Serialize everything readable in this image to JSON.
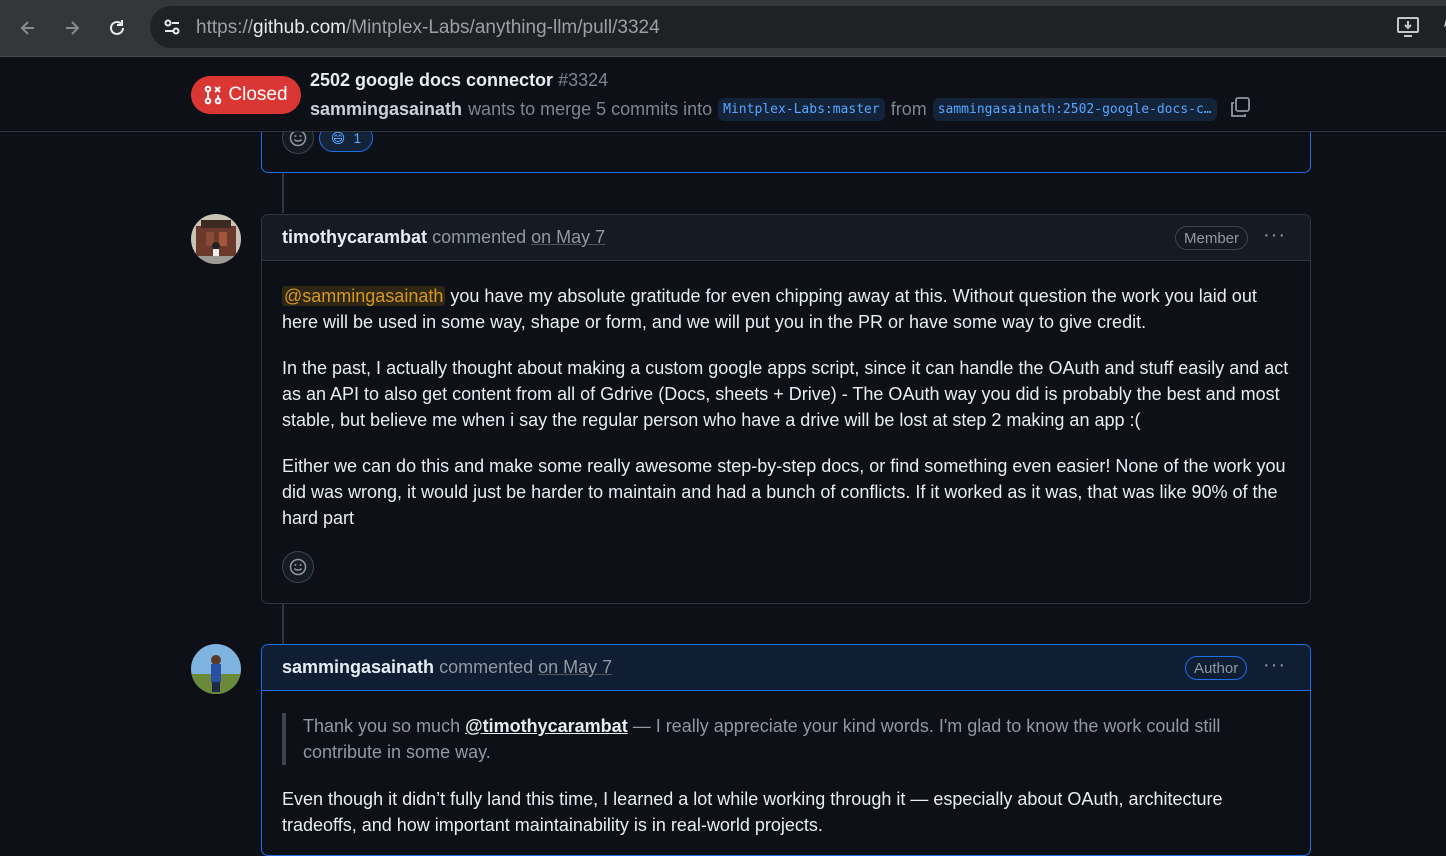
{
  "browser": {
    "url_scheme": "https://",
    "url_host": "github.com",
    "url_path": "/Mintplex-Labs/anything-llm/pull/3324"
  },
  "pr": {
    "state": "Closed",
    "title": "2502 google docs connector",
    "number": "#3324",
    "author": "sammingasainath",
    "merge_text": "wants to merge 5 commits into",
    "base_branch": "Mintplex-Labs:master",
    "from_text": "from",
    "head_branch": "sammingasainath:2502-google-docs-c…",
    "state_color": "#da3633"
  },
  "previous_reaction": {
    "emoji": "😄",
    "count": "1"
  },
  "comments": [
    {
      "user": "timothycarambat",
      "action": "commented",
      "date": "on May 7",
      "role": "Member",
      "mention": "@sammingasainath",
      "paragraph1_rest": " you have my absolute gratitude for even chipping away at this. Without question the work you laid out here will be used in some way, shape or form, and we will put you in the PR or have some way to give credit.",
      "paragraph2": "In the past, I actually thought about making a custom google apps script, since it can handle the OAuth and stuff easily and act as an API to also get content from all of Gdrive (Docs, sheets + Drive) - The OAuth way you did is probably the best and most stable, but believe me when i say the regular person who have a drive will be lost at step 2 making an app :(",
      "paragraph3": "Either we can do this and make some really awesome step-by-step docs, or find something even easier! None of the work you did was wrong, it would just be harder to maintain and had a bunch of conflicts. If it worked as it was, that was like 90% of the hard part"
    },
    {
      "user": "sammingasainath",
      "action": "commented",
      "date": "on May 7",
      "role": "Author",
      "quote_start": "Thank you so much ",
      "quote_mention": "@timothycarambat",
      "quote_rest": " — I really appreciate your kind words. I'm glad to know the work could still contribute in some way.",
      "paragraph1": "Even though it didn’t fully land this time, I learned a lot while working through it — especially about OAuth, architecture tradeoffs, and how important maintainability is in real-world projects."
    }
  ],
  "icons": {
    "back": "arrow-left-icon",
    "forward": "arrow-right-icon",
    "reload": "reload-icon",
    "site_info": "tune-icon",
    "install": "install-icon",
    "copy": "copy-icon",
    "smiley": "smiley-icon",
    "kebab": "kebab-horizontal-icon"
  }
}
